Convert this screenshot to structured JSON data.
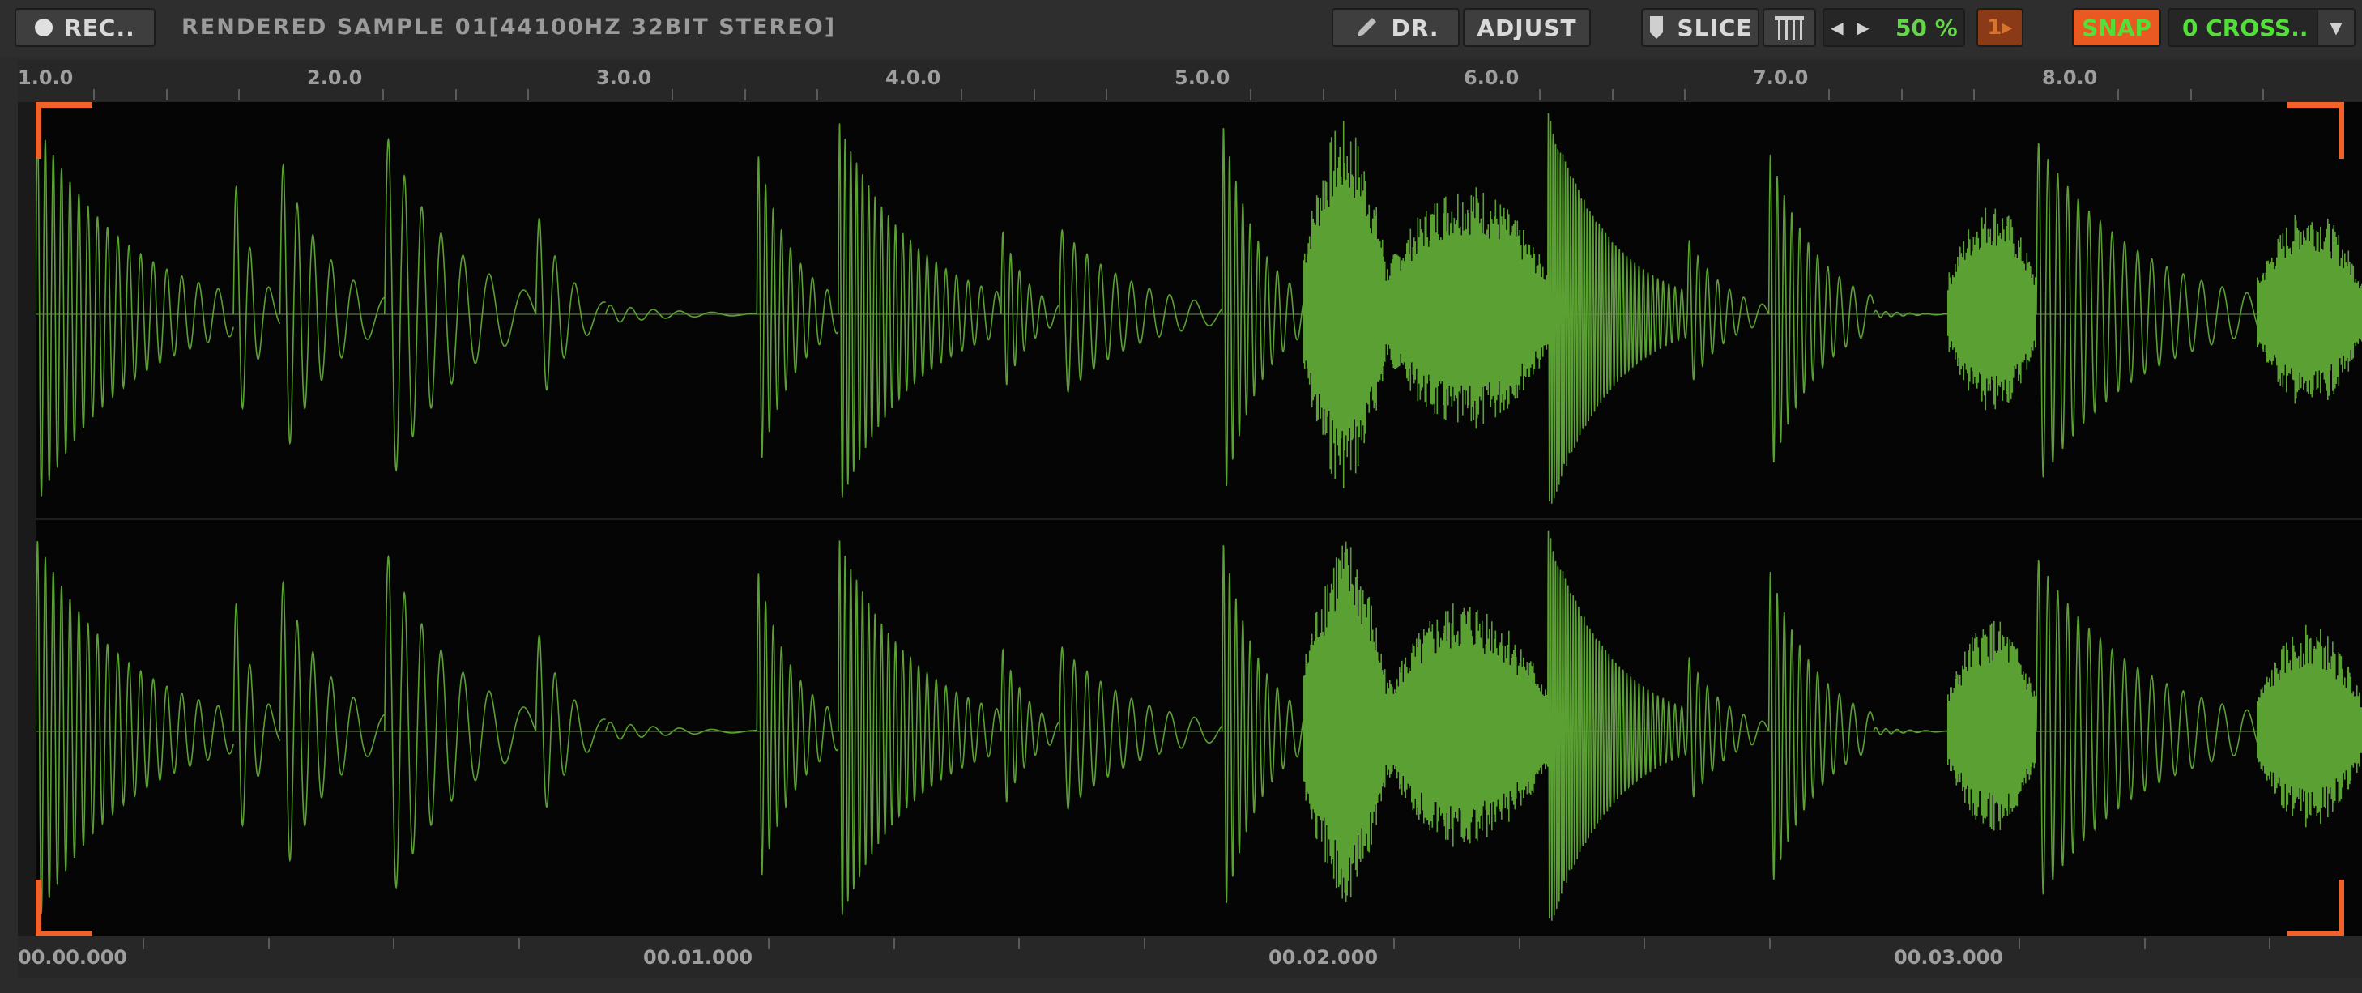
{
  "toolbar": {
    "rec_label": "REC..",
    "sample_title": "RENDERED SAMPLE 01[44100HZ 32BIT STEREO]",
    "draw_label": "DR.",
    "adjust_label": "ADJUST",
    "slice_label": "SLICE",
    "zoom_percent": "50 %",
    "one_label": "1▸",
    "snap_label": "SNAP",
    "cross_label": "0 CROSS..",
    "icons": {
      "rec": "record-dot-icon",
      "draw": "pencil-icon",
      "slice": "slice-marker-icon",
      "slices_view": "slice-lines-icon",
      "prev": "arrow-left-icon",
      "next": "arrow-right-icon",
      "dropdown": "chevron-down-icon"
    }
  },
  "ruler": {
    "bars": [
      "1.0.0",
      "2.0.0",
      "3.0.0",
      "4.0.0",
      "5.0.0",
      "6.0.0",
      "7.0.0",
      "8.0.0"
    ]
  },
  "timeline": {
    "labels": [
      "00.00.000",
      "00.01.000",
      "00.02.000",
      "00.03.000"
    ]
  },
  "colors": {
    "waveform": "#5aa032",
    "selection_marker": "#f0622a",
    "snap_active": "#e85a22",
    "value_text": "#52e038"
  }
}
